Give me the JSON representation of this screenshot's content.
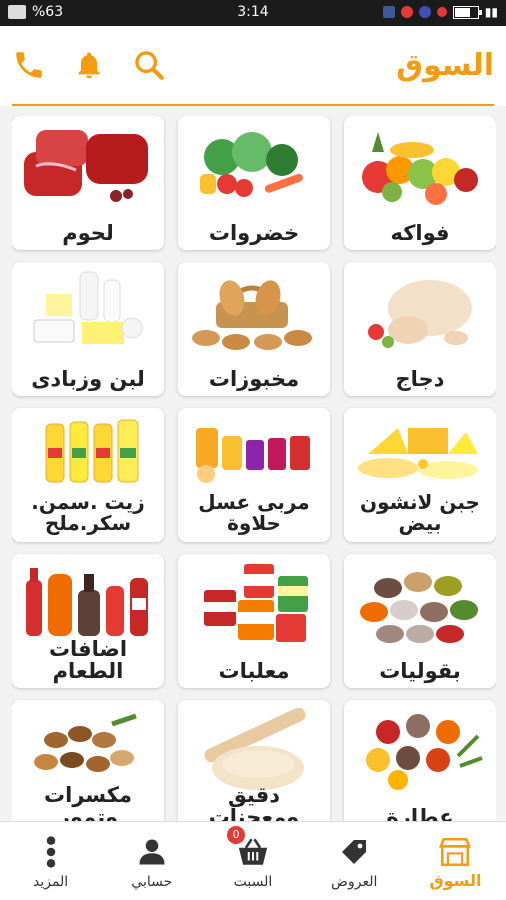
{
  "status_bar": {
    "battery": "%63",
    "time": "3:14"
  },
  "header": {
    "title": "السوق",
    "accent_color": "#f39c12",
    "icons": [
      "phone-icon",
      "bell-icon",
      "search-icon"
    ]
  },
  "categories": [
    {
      "label": "فواكه",
      "image": "fruits"
    },
    {
      "label": "خضروات",
      "image": "vegetables"
    },
    {
      "label": "لحوم",
      "image": "meat"
    },
    {
      "label": "دجاج",
      "image": "chicken"
    },
    {
      "label": "مخبوزات",
      "image": "bakery"
    },
    {
      "label": "لبن وزبادى",
      "image": "dairy"
    },
    {
      "label": "جبن لانشون بيض",
      "image": "cheese"
    },
    {
      "label": "مربى عسل حلاوة",
      "image": "jam-honey"
    },
    {
      "label": "زيت .سمن. سكر.ملح",
      "image": "oil"
    },
    {
      "label": "بقوليات",
      "image": "legumes"
    },
    {
      "label": "معلبات",
      "image": "canned"
    },
    {
      "label": "اضافات الطعام",
      "image": "sauces"
    },
    {
      "label": "عطارة",
      "image": "spices"
    },
    {
      "label": "دقيق ومعجنات",
      "image": "flour-dough"
    },
    {
      "label": "مكسرات وتمور",
      "image": "nuts"
    }
  ],
  "bottom_nav": {
    "items": [
      {
        "label": "السوق",
        "icon": "market-icon",
        "active": true
      },
      {
        "label": "العروض",
        "icon": "tag-icon",
        "active": false
      },
      {
        "label": "السبت",
        "icon": "basket-icon",
        "active": false,
        "badge": "0"
      },
      {
        "label": "حسابي",
        "icon": "user-icon",
        "active": false
      },
      {
        "label": "المزيد",
        "icon": "more-icon",
        "active": false
      }
    ]
  }
}
